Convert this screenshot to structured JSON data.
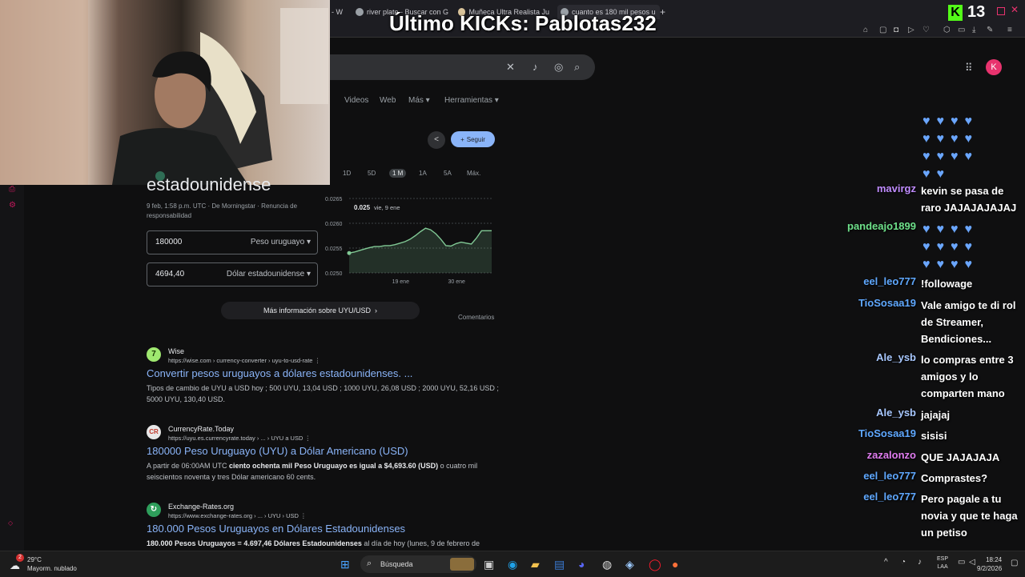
{
  "browser": {
    "tabs": [
      {
        "label": "- W"
      },
      {
        "label": "river plate - Buscar con G"
      },
      {
        "label": "Muñeca Ultra Realista Ju"
      },
      {
        "label": "cuanto es 180 mil pesos u"
      }
    ],
    "new_tab": "+"
  },
  "stream": {
    "overlay_title": "Último KICKs: Pablotas232",
    "viewer_count": "13",
    "kick_logo": "K"
  },
  "search": {
    "nav": [
      "Videos",
      "Web",
      "Más",
      "Herramientas"
    ],
    "follow_label": "Seguir"
  },
  "finance": {
    "heading": "estadounidense",
    "date_info": "9 feb, 1:58 p.m. UTC · De Morningstar · Renuncia de responsabilidad",
    "ranges": [
      "1D",
      "5D",
      "1 M",
      "1A",
      "5A",
      "Máx."
    ],
    "from_amount": "180000",
    "from_currency": "Peso uruguayo",
    "to_amount": "4694,40",
    "to_currency": "Dólar estadounidense",
    "more_info": "Más información sobre UYU/USD",
    "comments": "Comentarios"
  },
  "chart_data": {
    "type": "line",
    "y_ticks": [
      "0.0265",
      "0.0260",
      "0.0255",
      "0.0250"
    ],
    "x_ticks": [
      "19 ene",
      "30 ene"
    ],
    "ylim": [
      0.025,
      0.0265
    ],
    "tooltip_value": "0.025",
    "tooltip_date": "vie, 9 ene",
    "values": [
      0.0254,
      0.02542,
      0.02545,
      0.02548,
      0.02551,
      0.02553,
      0.02553,
      0.02555,
      0.02555,
      0.02557,
      0.0256,
      0.02563,
      0.02568,
      0.02575,
      0.02583,
      0.0259,
      0.02587,
      0.02579,
      0.02568,
      0.02555,
      0.02554,
      0.02559,
      0.02562,
      0.0256,
      0.02558,
      0.0257,
      0.02585,
      0.02585,
      0.02585
    ]
  },
  "results": [
    {
      "site": "Wise",
      "icon": "7",
      "url": "https://wise.com › currency-converter › uyu-to-usd-rate",
      "title": "Convertir pesos uruguayos a dólares estadounidenses. ...",
      "snippet": "Tipos de cambio de UYU a USD hoy ; 500 UYU, 13,04 USD ; 1000 UYU, 26,08 USD ; 2000 UYU, 52,16 USD ; 5000 UYU, 130,40 USD."
    },
    {
      "site": "CurrencyRate.Today",
      "icon": "CR",
      "url": "https://uyu.es.currencyrate.today › ... › UYU a USD",
      "title": "180000 Peso Uruguayo (UYU) a Dólar Americano (USD)",
      "snippet_pre": "A partir de 06:00AM UTC ",
      "snippet_bold": "ciento ochenta mil Peso Uruguayo es igual a $4,693.60 (USD)",
      "snippet_post": " o cuatro mil seiscientos noventa y tres Dólar americano 60 cents."
    },
    {
      "site": "Exchange-Rates.org",
      "icon": "↻",
      "url": "https://www.exchange-rates.org › ... › UYU › USD",
      "title": "180.000 Pesos Uruguayos en Dólares Estadounidenses",
      "snippet_bold": "180.000 Pesos Uruguayos = 4.697,46 Dólares Estadounidenses",
      "snippet_post": " al día de hoy (lunes, 9 de febrero de"
    }
  ],
  "profile": {
    "initial": "K"
  },
  "chat": [
    {
      "user": "mavirgz",
      "message": "kevin se pasa de raro JAJAJAJAJAJ",
      "color": "#c08cff"
    },
    {
      "user": "pandeajo1899",
      "message": "",
      "color": "#6ee08a"
    },
    {
      "user": "eel_leo777",
      "message": "!followage",
      "color": "#5fa8ff"
    },
    {
      "user": "TioSosaa19",
      "message": "Vale amigo te di rol de Streamer, Bendiciones...",
      "color": "#5fa8ff"
    },
    {
      "user": "Ale_ysb",
      "message": "lo compras entre 3 amigos y lo comparten mano",
      "color": "#a8c8ff"
    },
    {
      "user": "Ale_ysb",
      "message": "jajajaj",
      "color": "#a8c8ff"
    },
    {
      "user": "TioSosaa19",
      "message": "sisisi",
      "color": "#5fa8ff"
    },
    {
      "user": "zazalonzo",
      "message": "QUE JAJAJAJA",
      "color": "#e07cf0"
    },
    {
      "user": "eel_leo777",
      "message": "Comprastes?",
      "color": "#5fa8ff"
    },
    {
      "user": "eel_leo777",
      "message": "Pero pagale a tu novia y que te haga un petiso",
      "color": "#5fa8ff"
    }
  ],
  "taskbar": {
    "weather_temp": "29°C",
    "weather_desc": "Mayorm. nublado",
    "weather_badge": "2",
    "search_label": "Búsqueda",
    "lang_1": "ESP",
    "lang_2": "LAA",
    "time": "18:24",
    "date": "9/2/2026"
  }
}
